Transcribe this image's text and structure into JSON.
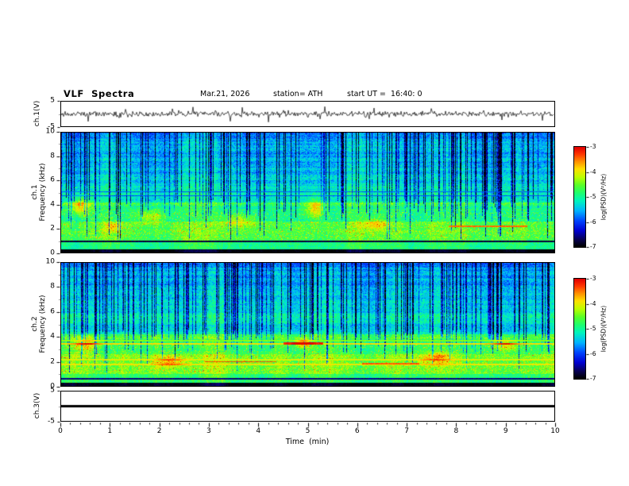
{
  "title": "VLF  Spectra",
  "header": {
    "date": "Mar.21, 2026",
    "station": "station= ATH",
    "start_ut": "start UT =  16:40: 0"
  },
  "xlabel": "Time  (min)",
  "xlim": [
    0,
    10
  ],
  "xticks": [
    0,
    1,
    2,
    3,
    4,
    5,
    6,
    7,
    8,
    9,
    10
  ],
  "chart_data": [
    {
      "type": "line",
      "name": "ch1-waveform",
      "ylabel": "ch.1(V)",
      "ylim": [
        -5,
        5
      ],
      "yticks": [
        5,
        -5
      ],
      "seed": 11,
      "description": "Broadband noise waveform about 0 V with impulsive spikes up to ±4 V across the full 10 min record"
    },
    {
      "type": "heatmap",
      "name": "ch1-spectrogram",
      "ylabel_lines": [
        "ch.1",
        "Frequency (kHz)"
      ],
      "ylim": [
        0,
        10
      ],
      "yticks": [
        0,
        2,
        4,
        6,
        8,
        10
      ],
      "colormap": "rainbow (black-blue-cyan-green-yellow-red)",
      "colorbar": {
        "label": "log(PSD)(V²/Hz)",
        "ticks": [
          -3,
          -4,
          -5,
          -6,
          -7
        ],
        "range": [
          -3,
          -7
        ]
      },
      "seed": 42,
      "bands": [
        {
          "f_lo": 0.0,
          "f_hi": 0.32,
          "psd": -6.95,
          "noise": 0.12
        },
        {
          "f_lo": 0.32,
          "f_hi": 1.0,
          "psd": -4.9,
          "noise": 0.4
        },
        {
          "f_lo": 1.0,
          "f_hi": 2.6,
          "psd": -4.6,
          "noise": 0.5
        },
        {
          "f_lo": 2.6,
          "f_hi": 4.2,
          "psd": -4.95,
          "noise": 0.5
        },
        {
          "f_lo": 4.2,
          "f_hi": 6.0,
          "psd": -5.25,
          "noise": 0.5
        },
        {
          "f_lo": 6.0,
          "f_hi": 10.0,
          "psd": -5.4,
          "noise": 0.5
        }
      ],
      "hlines": [
        {
          "f": 0.95,
          "psd": -6.8,
          "th": 0.05
        },
        {
          "f": 4.78,
          "psd": -5.95,
          "th": 0.04
        },
        {
          "f": 5.12,
          "psd": -5.9,
          "th": 0.04
        },
        {
          "f": 2.2,
          "psd": -3.45,
          "th": 0.06,
          "x0": 7.85,
          "x1": 9.45
        }
      ],
      "blobs": [
        {
          "x": 0.38,
          "f": 3.9,
          "dx": 0.22,
          "df": 0.75,
          "amp": 1.25
        },
        {
          "x": 1.05,
          "f": 2.2,
          "dx": 0.18,
          "df": 0.4,
          "amp": 0.7
        },
        {
          "x": 1.8,
          "f": 3.0,
          "dx": 0.3,
          "df": 0.55,
          "amp": 0.85
        },
        {
          "x": 3.6,
          "f": 2.7,
          "dx": 0.35,
          "df": 0.5,
          "amp": 0.75
        },
        {
          "x": 5.15,
          "f": 3.7,
          "dx": 0.2,
          "df": 0.8,
          "amp": 1.1
        },
        {
          "x": 6.35,
          "f": 2.4,
          "dx": 0.3,
          "df": 0.45,
          "amp": 0.7
        }
      ]
    },
    {
      "type": "heatmap",
      "name": "ch2-spectrogram",
      "ylabel_lines": [
        "ch.2",
        "Frequency (kHz)"
      ],
      "ylim": [
        0,
        10
      ],
      "yticks": [
        0,
        2,
        4,
        6,
        8,
        10
      ],
      "colormap": "rainbow (black-blue-cyan-green-yellow-red)",
      "colorbar": {
        "label": "log(PSD)(V²/Hz)",
        "ticks": [
          -3,
          -4,
          -5,
          -6,
          -7
        ],
        "range": [
          -3,
          -7
        ]
      },
      "seed": 77,
      "bands": [
        {
          "f_lo": 0.0,
          "f_hi": 0.32,
          "psd": -6.95,
          "noise": 0.12
        },
        {
          "f_lo": 0.32,
          "f_hi": 1.0,
          "psd": -4.85,
          "noise": 0.45
        },
        {
          "f_lo": 1.0,
          "f_hi": 2.6,
          "psd": -4.45,
          "noise": 0.5
        },
        {
          "f_lo": 2.6,
          "f_hi": 4.2,
          "psd": -4.7,
          "noise": 0.5
        },
        {
          "f_lo": 4.2,
          "f_hi": 6.0,
          "psd": -5.15,
          "noise": 0.5
        },
        {
          "f_lo": 6.0,
          "f_hi": 10.0,
          "psd": -5.35,
          "noise": 0.5
        }
      ],
      "hlines": [
        {
          "f": 0.6,
          "psd": -6.6,
          "th": 0.05
        },
        {
          "f": 1.8,
          "psd": -3.95,
          "th": 0.07
        },
        {
          "f": 2.15,
          "psd": -4.05,
          "th": 0.06
        },
        {
          "f": 3.45,
          "psd": -3.9,
          "th": 0.08
        },
        {
          "f": 3.72,
          "psd": -4.4,
          "th": 0.05
        },
        {
          "f": 2.0,
          "psd": -3.35,
          "th": 0.06,
          "x0": 2.9,
          "x1": 4.35
        },
        {
          "f": 3.5,
          "psd": -3.2,
          "th": 0.09,
          "x0": 4.5,
          "x1": 5.3
        },
        {
          "f": 1.85,
          "psd": -3.4,
          "th": 0.05,
          "x0": 6.1,
          "x1": 7.25
        }
      ],
      "blobs": [
        {
          "x": 0.5,
          "f": 3.4,
          "dx": 0.25,
          "df": 0.6,
          "amp": 0.9
        },
        {
          "x": 2.2,
          "f": 2.0,
          "dx": 0.3,
          "df": 0.4,
          "amp": 0.8
        },
        {
          "x": 4.9,
          "f": 3.5,
          "dx": 0.15,
          "df": 0.35,
          "amp": 1.3
        },
        {
          "x": 7.6,
          "f": 2.3,
          "dx": 0.3,
          "df": 0.5,
          "amp": 0.8
        },
        {
          "x": 9.0,
          "f": 3.3,
          "dx": 0.25,
          "df": 0.5,
          "amp": 0.9
        }
      ]
    },
    {
      "type": "line",
      "name": "ch3-flatline",
      "ylabel": "ch.3(V)",
      "ylim": [
        -5,
        5
      ],
      "yticks": [
        5,
        -5
      ],
      "value": 0,
      "description": "Constant 0 V (flat thick black trace), no signal on channel 3"
    }
  ]
}
